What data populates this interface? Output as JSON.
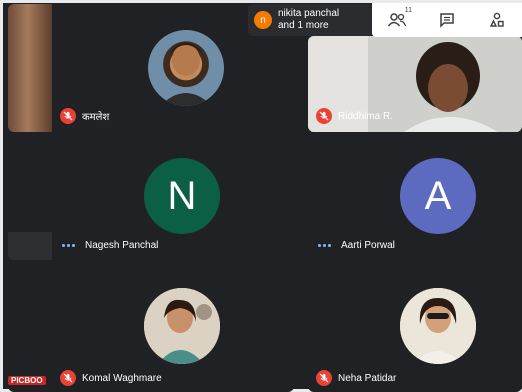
{
  "topbar": {
    "chip_avatar_letter": "n",
    "chip_line1": "nikita panchal",
    "chip_line2": "and 1 more",
    "people_count": "11"
  },
  "participants": [
    {
      "name": "कमलेश",
      "muted": true,
      "avatar": "photo"
    },
    {
      "name": "Riddhima R.",
      "muted": true,
      "avatar": "video"
    },
    {
      "name": "Nagesh Panchal",
      "muted": false,
      "avatar": "N",
      "avatar_color": "#0b5f45"
    },
    {
      "name": "Aarti Porwal",
      "muted": false,
      "avatar": "A",
      "avatar_color": "#5c6bc0"
    },
    {
      "name": "Komal Waghmare",
      "muted": true,
      "avatar": "photo"
    },
    {
      "name": "Neha Patidar",
      "muted": true,
      "avatar": "photo"
    }
  ],
  "watermark": "PICBOO"
}
